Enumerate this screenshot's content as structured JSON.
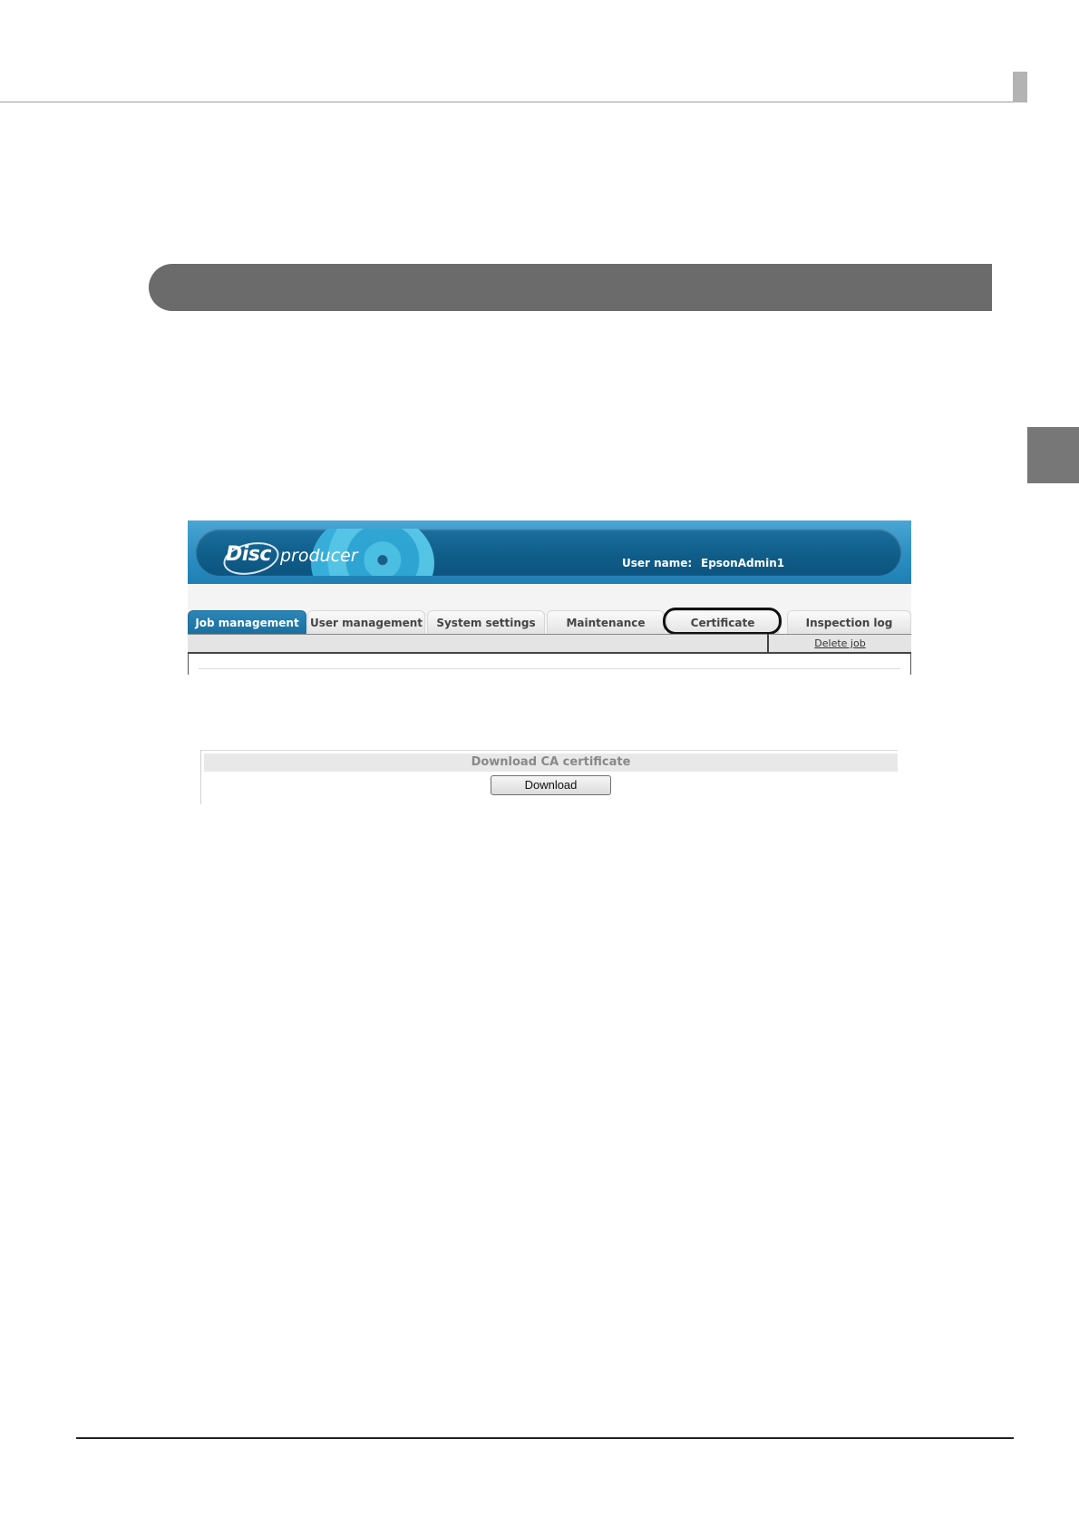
{
  "app": {
    "logo": {
      "word1": "Disc",
      "word2": "producer"
    },
    "user_label": "User name:",
    "user_name": "EpsonAdmin1",
    "tabs": [
      {
        "label": "Job management",
        "active": true
      },
      {
        "label": "User management",
        "active": false
      },
      {
        "label": "System settings",
        "active": false
      },
      {
        "label": "Maintenance",
        "active": false
      },
      {
        "label": "Certificate",
        "active": false,
        "highlighted": true
      },
      {
        "label": "Inspection log",
        "active": false
      }
    ],
    "subbar_link": "Delete job"
  },
  "certificate_panel": {
    "heading": "Download CA certificate",
    "button_label": "Download"
  },
  "colors": {
    "header_blue": "#1b6f9e",
    "section_bar": "#6b6b6b",
    "side_tab": "#777777"
  }
}
